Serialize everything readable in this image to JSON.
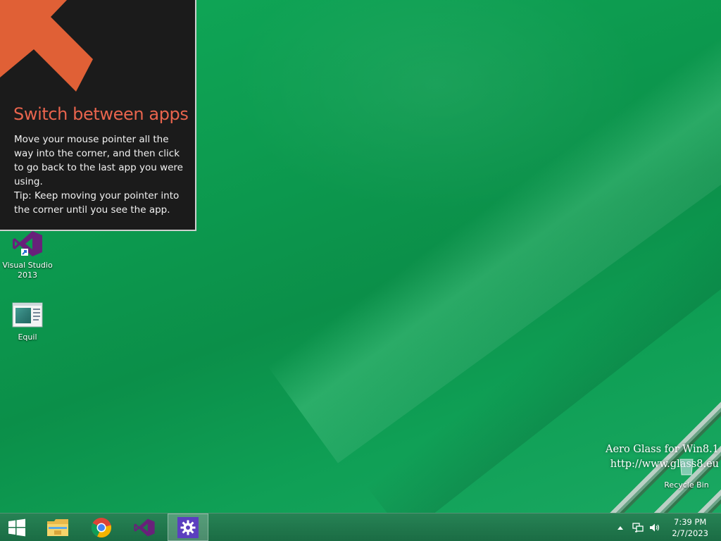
{
  "tip": {
    "title": "Switch between apps",
    "body_1": "Move your mouse pointer all the way into the corner, and then click to go back to the last app you were using.",
    "body_2": "Tip: Keep moving your pointer into the corner until you see the app.",
    "accent_color": "#e8644d",
    "icon": "arrow-up-left-icon"
  },
  "desktop": {
    "icons": [
      {
        "label": "Visual Studio 2013",
        "icon": "visual-studio-icon"
      },
      {
        "label": "Equil",
        "icon": "equil-app-icon"
      },
      {
        "label": "Recycle Bin",
        "icon": "recycle-bin-icon"
      }
    ],
    "watermark_line1": "Aero Glass for Win8.1",
    "watermark_line2": "http://www.glass8.eu"
  },
  "taskbar": {
    "items": [
      {
        "name": "Start",
        "icon": "windows-logo-icon"
      },
      {
        "name": "File Explorer",
        "icon": "file-explorer-icon"
      },
      {
        "name": "Google Chrome",
        "icon": "chrome-icon"
      },
      {
        "name": "Visual Studio",
        "icon": "visual-studio-icon"
      },
      {
        "name": "Settings",
        "icon": "gear-icon",
        "active": true
      }
    ],
    "tray": {
      "icons": [
        "show-hidden-icons-icon",
        "network-icon",
        "volume-icon"
      ],
      "time": "7:39 PM",
      "date": "2/7/2023"
    }
  }
}
